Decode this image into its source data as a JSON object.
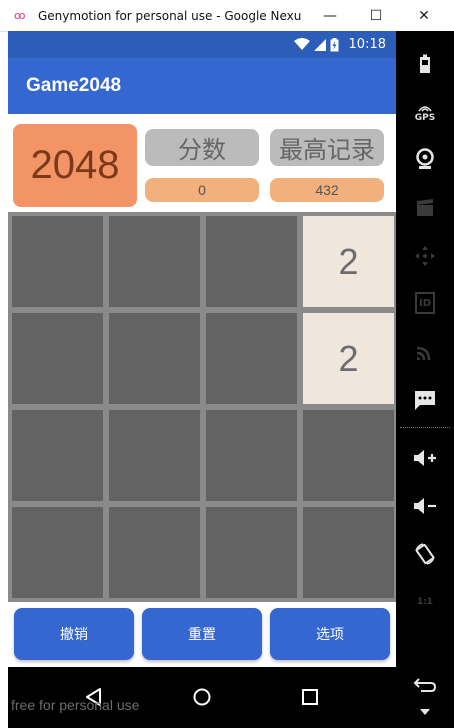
{
  "window": {
    "title": "Genymotion for personal use - Google Nexu",
    "logo": "oo",
    "minimize_glyph": "—",
    "maximize_glyph": "☐",
    "close_glyph": "✕"
  },
  "statusbar": {
    "time": "10:18"
  },
  "app": {
    "title": "Game2048",
    "logo_text": "2048",
    "score_label": "分数",
    "best_label": "最高记录",
    "score_value": "0",
    "best_value": "432"
  },
  "board": {
    "size": 4,
    "cells": [
      [
        "",
        "",
        "",
        "2"
      ],
      [
        "",
        "",
        "",
        "2"
      ],
      [
        "",
        "",
        "",
        ""
      ],
      [
        "",
        "",
        "",
        ""
      ]
    ]
  },
  "buttons": {
    "undo": "撤销",
    "reset": "重置",
    "options": "选项"
  },
  "watermark": "free for personal use",
  "sidebar": {
    "icons": [
      "battery-icon",
      "gps-icon",
      "webcam-icon",
      "capture-icon",
      "dpad-icon",
      "id-icon",
      "cast-icon",
      "message-icon",
      "volume-up-icon",
      "volume-down-icon",
      "rotate-icon",
      "pixel-perfect-icon",
      "back-icon",
      "menu-icon"
    ],
    "gps_text": "GPS",
    "id_text": "ID",
    "pixel_text": "1:1"
  },
  "colors": {
    "appbar": "#3467cf",
    "statusbar": "#2c5db8",
    "logo_tile": "#f39466",
    "score_label_bg": "#bbbbbb",
    "score_value_bg": "#f2b07c",
    "empty_cell": "#636363",
    "tile_2": "#efe6dc",
    "board_bg": "#8a8a8a"
  }
}
